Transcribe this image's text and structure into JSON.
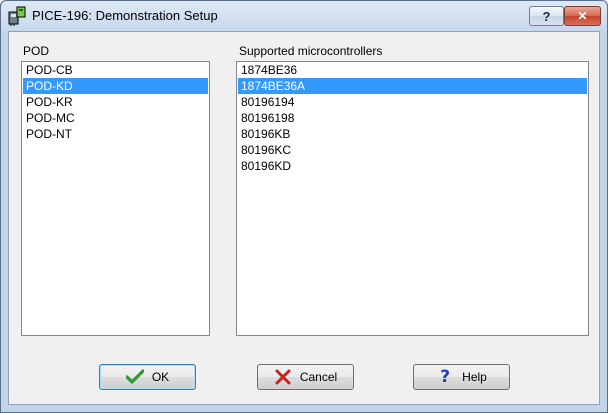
{
  "window": {
    "title": "PICE-196: Demonstration Setup",
    "help_glyph": "?",
    "close_glyph": "✕"
  },
  "pod_panel": {
    "label": "POD",
    "items": [
      "POD-CB",
      "POD-KD",
      "POD-KR",
      "POD-MC",
      "POD-NT"
    ],
    "selected_index": 1
  },
  "mcu_panel": {
    "label": "Supported microcontrollers",
    "items": [
      "1874BE36",
      "1874BE36A",
      "80196194",
      "80196198",
      "80196KB",
      "80196KC",
      "80196KD"
    ],
    "selected_index": 1
  },
  "buttons": {
    "ok": "OK",
    "cancel": "Cancel",
    "help": "Help"
  },
  "icons": {
    "ok": "checkmark-icon",
    "cancel": "cross-icon",
    "help": "question-icon"
  },
  "colors": {
    "selection": "#3399ff",
    "ok_check": "#2e9a2e",
    "cancel_cross": "#c8241c",
    "help_q": "#1a3fbf"
  }
}
